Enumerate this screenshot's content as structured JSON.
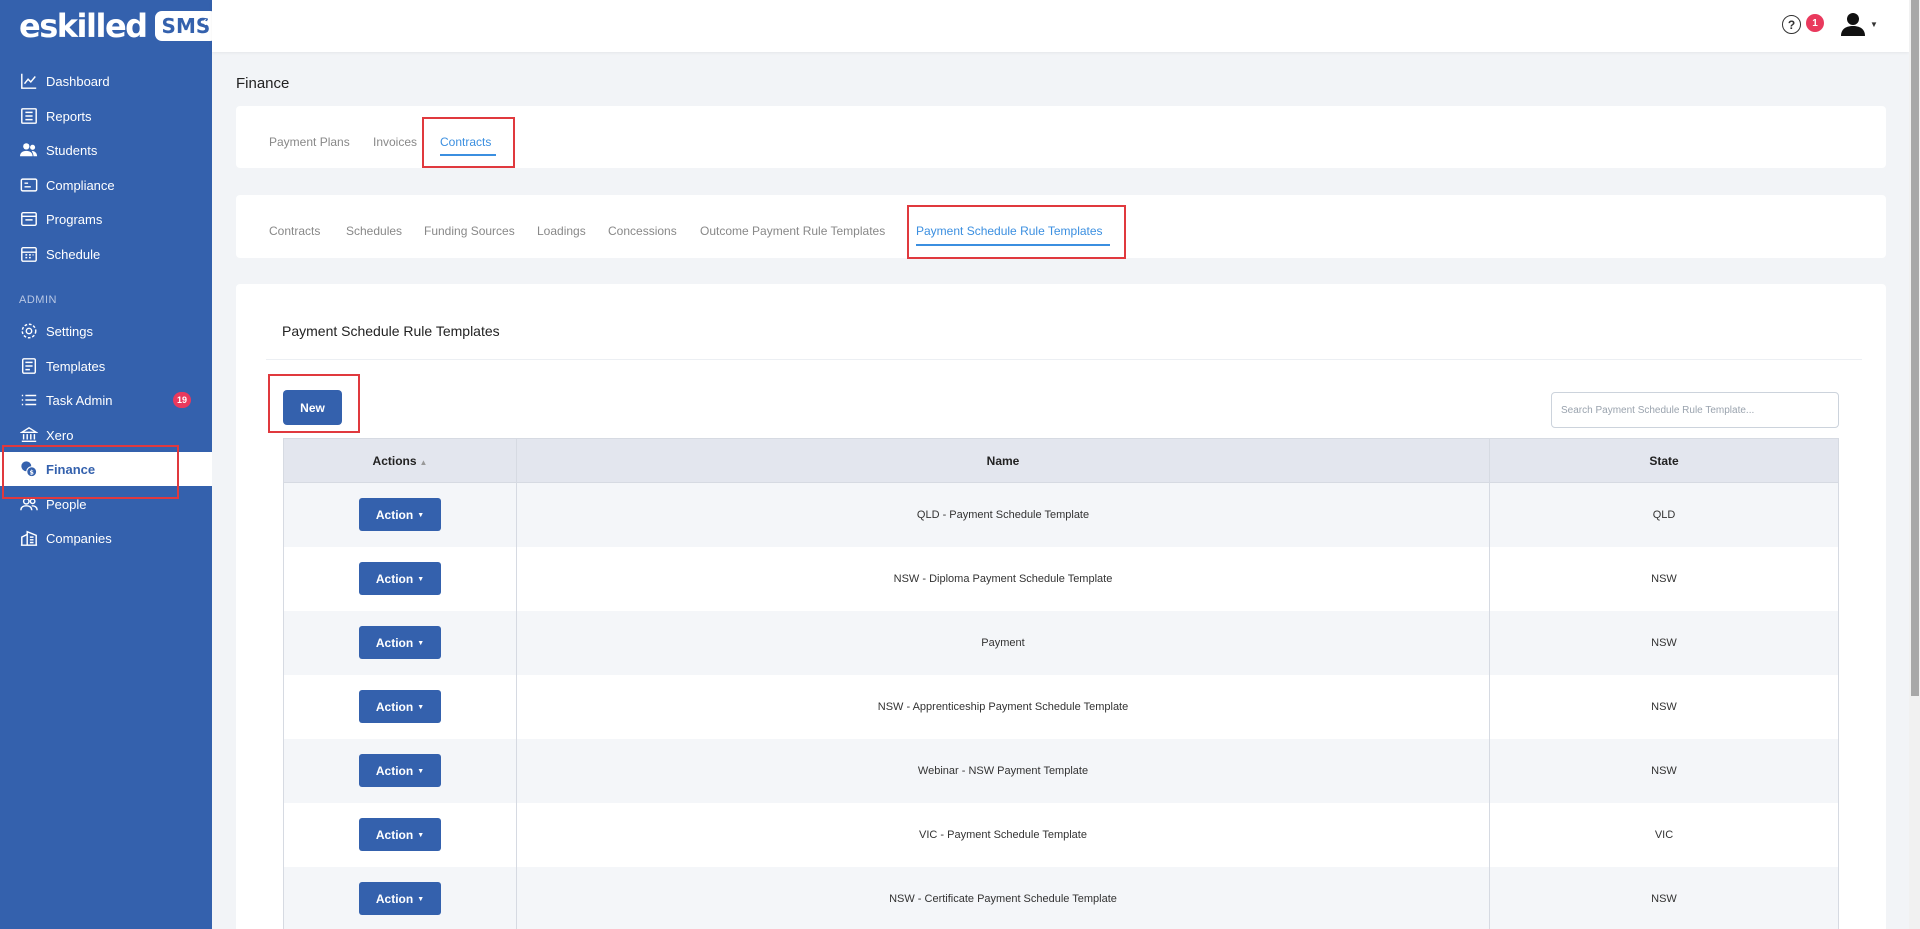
{
  "brand": {
    "name": "eskilled",
    "badge": "SMS"
  },
  "sidebar": {
    "collapse_icon": "«",
    "items": [
      {
        "label": "Dashboard",
        "icon": "chart-line-icon"
      },
      {
        "label": "Reports",
        "icon": "report-icon"
      },
      {
        "label": "Students",
        "icon": "users-icon"
      },
      {
        "label": "Compliance",
        "icon": "id-card-icon"
      },
      {
        "label": "Programs",
        "icon": "folder-icon"
      },
      {
        "label": "Schedule",
        "icon": "calendar-icon"
      }
    ],
    "admin_section": "ADMIN",
    "admin_items": [
      {
        "label": "Settings",
        "icon": "gear-icon"
      },
      {
        "label": "Templates",
        "icon": "template-icon"
      },
      {
        "label": "Task Admin",
        "icon": "list-icon",
        "badge": "19"
      },
      {
        "label": "Xero",
        "icon": "bank-icon"
      },
      {
        "label": "Finance",
        "icon": "coins-icon",
        "active": true
      },
      {
        "label": "People",
        "icon": "people-icon"
      },
      {
        "label": "Companies",
        "icon": "building-icon"
      }
    ]
  },
  "topbar": {
    "help_icon": "?",
    "notifications": "1"
  },
  "page": {
    "title": "Finance"
  },
  "tabs_primary": [
    "Payment Plans",
    "Invoices",
    "Contracts"
  ],
  "tabs_primary_active": "Contracts",
  "tabs_secondary": [
    "Contracts",
    "Schedules",
    "Funding Sources",
    "Loadings",
    "Concessions",
    "Outcome Payment Rule Templates",
    "Payment Schedule Rule Templates"
  ],
  "tabs_secondary_active": "Payment Schedule Rule Templates",
  "section": {
    "title": "Payment Schedule Rule Templates",
    "new_button": "New",
    "search_placeholder": "Search Payment Schedule Rule Template..."
  },
  "table": {
    "columns": [
      "Actions",
      "Name",
      "State"
    ],
    "sort_icon": "▲",
    "action_label": "Action",
    "caret": "▼",
    "rows": [
      {
        "name": "QLD - Payment Schedule Template",
        "state": "QLD"
      },
      {
        "name": "NSW - Diploma Payment Schedule Template",
        "state": "NSW"
      },
      {
        "name": "Payment",
        "state": "NSW"
      },
      {
        "name": "NSW - Apprenticeship Payment Schedule Template",
        "state": "NSW"
      },
      {
        "name": "Webinar - NSW Payment Template",
        "state": "NSW"
      },
      {
        "name": "VIC - Payment Schedule Template",
        "state": "VIC"
      },
      {
        "name": "NSW - Certificate Payment Schedule Template",
        "state": "NSW"
      }
    ]
  },
  "colors": {
    "primary": "#3461ad",
    "link": "#3b8fe0",
    "badge": "#e9395d",
    "highlight": "#e0393e"
  }
}
